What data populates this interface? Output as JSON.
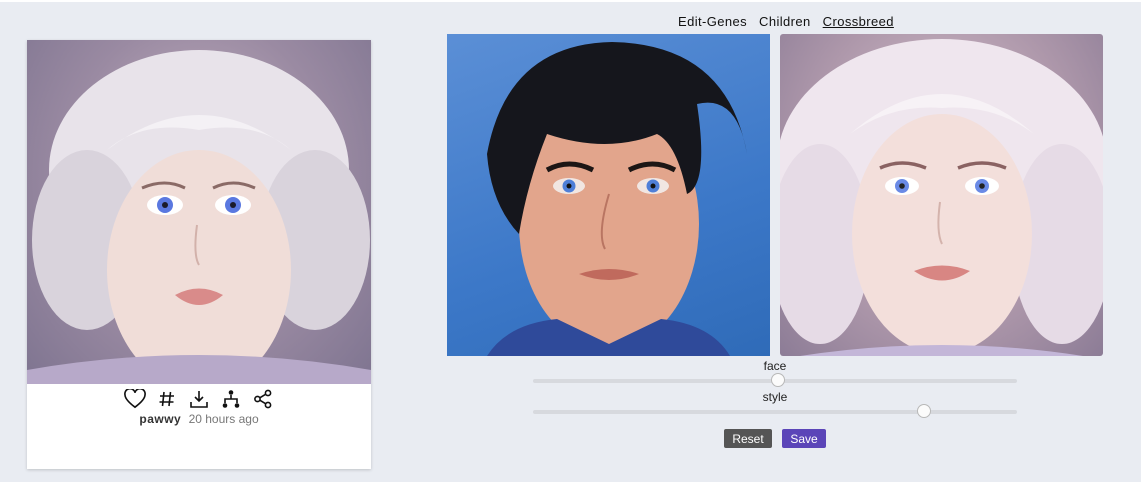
{
  "card": {
    "username": "pawwy",
    "time_ago": "20 hours ago",
    "actions": [
      "heart-icon",
      "hash-icon",
      "download-icon",
      "tree-icon",
      "share-icon"
    ]
  },
  "tabs": [
    {
      "label": "Edit-Genes",
      "active": false
    },
    {
      "label": "Children",
      "active": false
    },
    {
      "label": "Crossbreed",
      "active": true
    }
  ],
  "sliders": [
    {
      "label": "face",
      "value": 0.5
    },
    {
      "label": "style",
      "value": 0.8
    }
  ],
  "buttons": {
    "reset_label": "Reset",
    "save_label": "Save"
  },
  "colors": {
    "save": "#5b45b8",
    "reset": "#555555",
    "background": "#e9ecf2"
  }
}
